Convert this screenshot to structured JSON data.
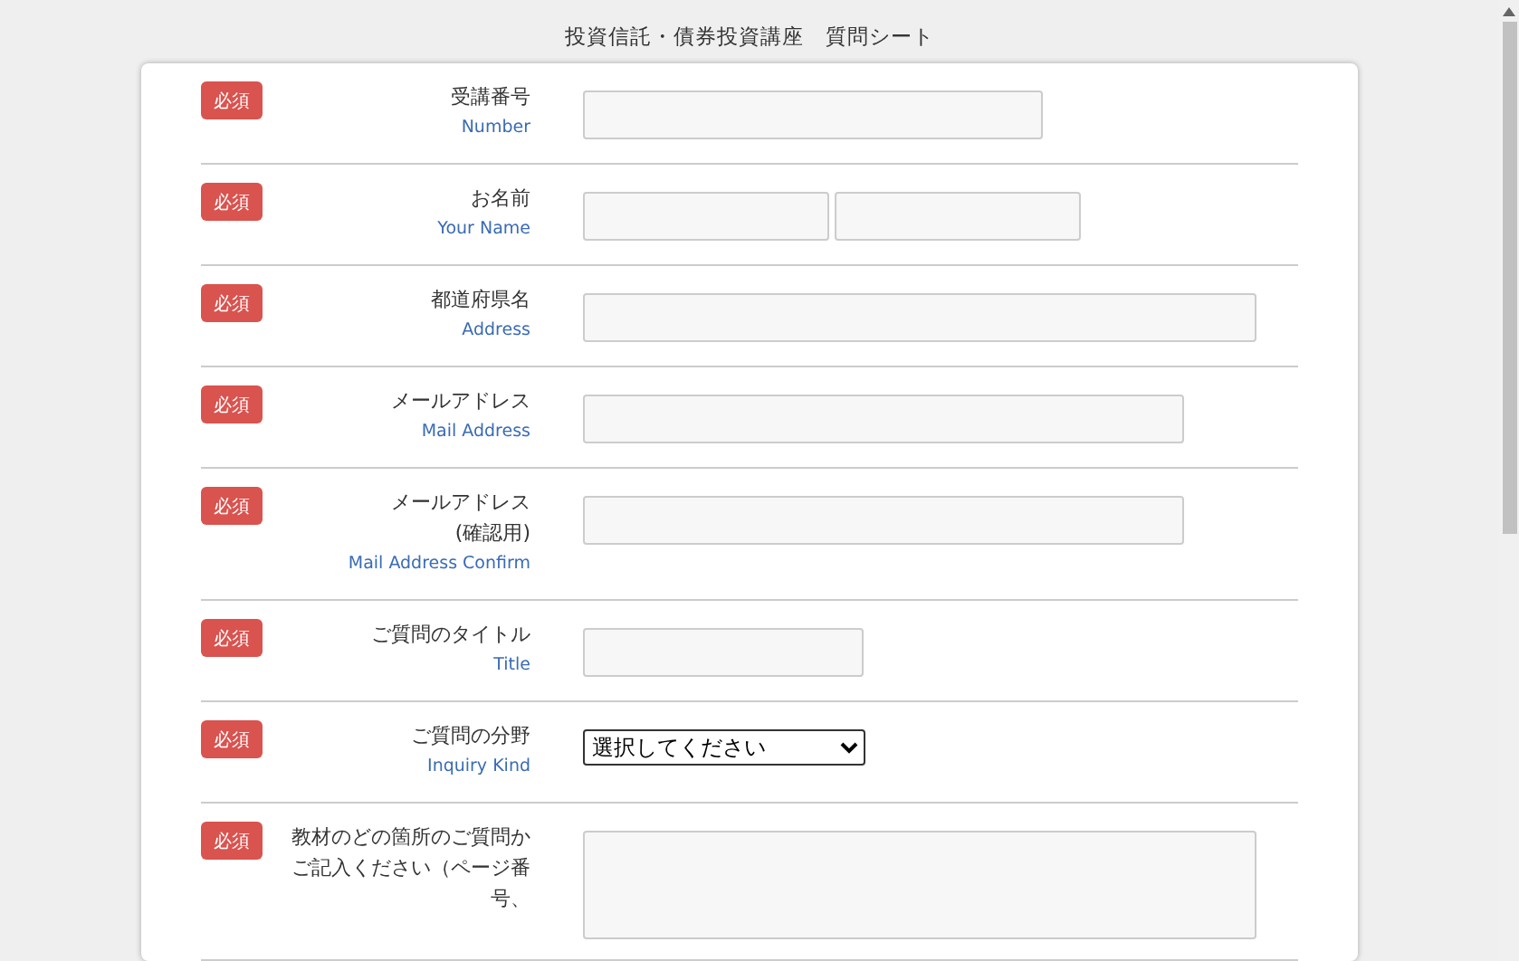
{
  "page_title": "投資信託・債券投資講座　質問シート",
  "rows": [
    {
      "required": true,
      "badge": "必須",
      "label": "受講番号",
      "label_en": "Number",
      "fields": [
        {
          "kind": "input"
        }
      ]
    },
    {
      "required": true,
      "badge": "必須",
      "label": "お名前",
      "label_en": "Your Name",
      "fields": [
        {
          "kind": "input"
        },
        {
          "kind": "input"
        }
      ]
    },
    {
      "required": true,
      "badge": "必須",
      "label": "都道府県名",
      "label_en": "Address",
      "fields": [
        {
          "kind": "input"
        }
      ]
    },
    {
      "required": true,
      "badge": "必須",
      "label": "メールアドレス",
      "label_en": "Mail Address",
      "fields": [
        {
          "kind": "input"
        }
      ]
    },
    {
      "required": true,
      "badge": "必須",
      "label": "メールアドレス\n(確認用)",
      "label_en": "Mail Address Confirm",
      "fields": [
        {
          "kind": "input"
        }
      ]
    },
    {
      "required": true,
      "badge": "必須",
      "label": "ご質問のタイトル",
      "label_en": "Title",
      "fields": [
        {
          "kind": "input"
        }
      ]
    },
    {
      "required": true,
      "badge": "必須",
      "label": "ご質問の分野",
      "label_en": "Inquiry Kind",
      "fields": [
        {
          "kind": "select",
          "value": "選択してください"
        }
      ]
    },
    {
      "required": true,
      "badge": "必須",
      "label": "教材のどの箇所のご質問かご記入ください（ページ番号、",
      "fields": [
        {
          "kind": "textarea"
        }
      ]
    }
  ]
}
